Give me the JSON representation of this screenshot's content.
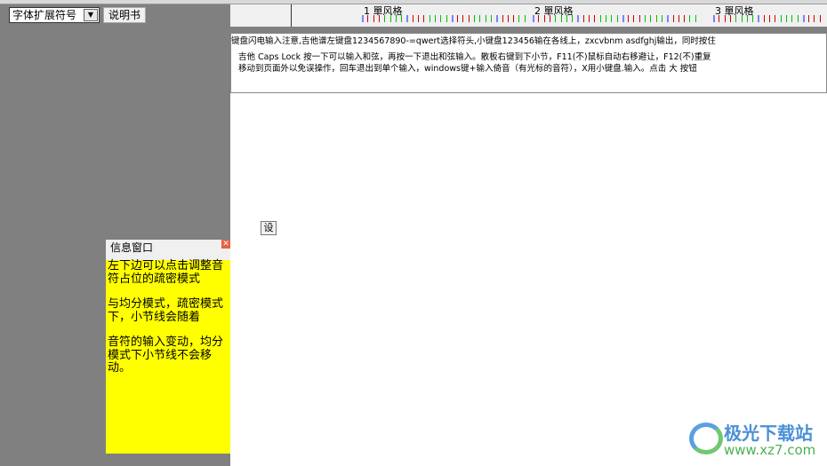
{
  "toolbar": {
    "font_select": "字体扩展符号",
    "manual_button": "说明书"
  },
  "ruler": {
    "measures": [
      {
        "label": "1 單风格"
      },
      {
        "label": "2 單风格"
      },
      {
        "label": "3 單风格"
      }
    ],
    "colors": {
      "blue": "#8080ff",
      "red": "#d00000",
      "green": "#00c000"
    }
  },
  "notice": {
    "line1": "键盘闪电输入注意,吉他谱左键盘1234567890-=qwert选择符头,小键盘123456输在各线上，zxcvbnm asdfghj输出，同时按住",
    "line2": "吉他 Caps Lock 按一下可以输入和弦，再按一下退出和弦输入。散板右键到下小节，F11(不)鼠标自动右移避让，F12(不)重复",
    "line3": "移动到页面外以免误操作，回车退出到单个输入，windows键+输入倚音（有光标的音符），X用小键盘.输入。点击  大  按钮"
  },
  "set_button": "设",
  "info_window": {
    "title": "信息窗口",
    "paragraphs": [
      "左下边可以点击调整音符占位的疏密模式",
      "与均分模式，疏密模式下，小节线会随着",
      "音符的输入变动，均分模式下小节线不会移动。"
    ]
  },
  "watermark": {
    "name": "极光下载站",
    "url": "www.xz7.com"
  }
}
